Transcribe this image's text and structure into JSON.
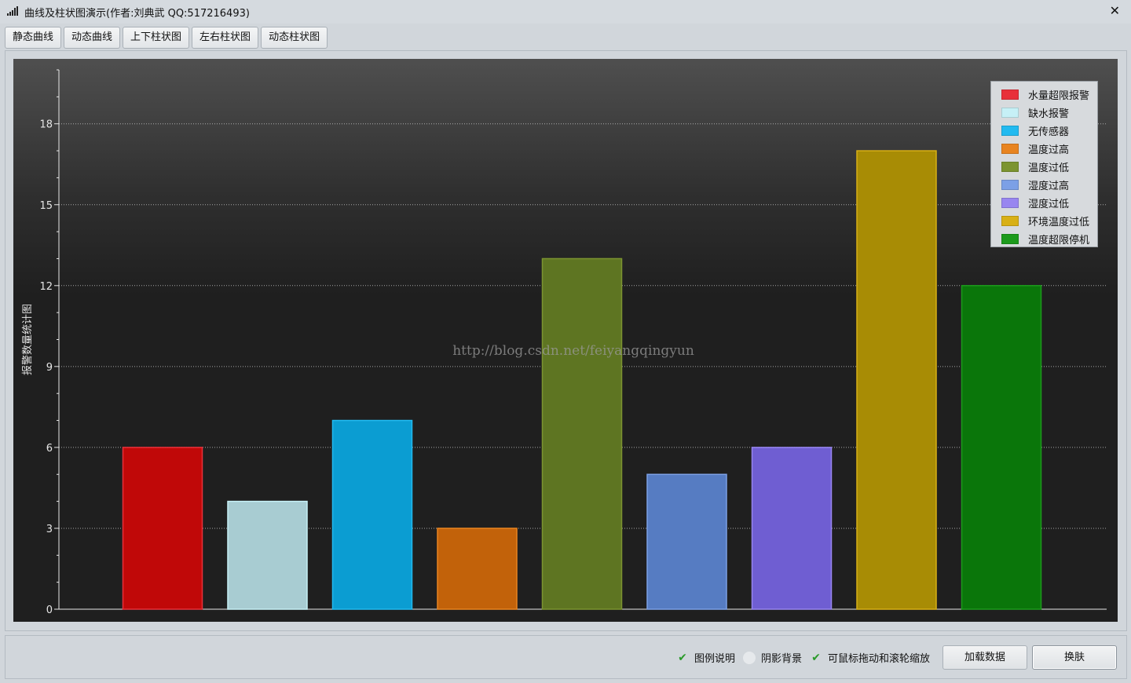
{
  "window": {
    "title": "曲线及柱状图演示(作者:刘典武 QQ:517216493)",
    "close_glyph": "✕"
  },
  "tabs": [
    {
      "label": "静态曲线"
    },
    {
      "label": "动态曲线"
    },
    {
      "label": "上下柱状图"
    },
    {
      "label": "左右柱状图"
    },
    {
      "label": "动态柱状图"
    }
  ],
  "watermark": "http://blog.csdn.net/feiyangqingyun",
  "chart_data": {
    "type": "bar",
    "ylabel": "报警数量统计图",
    "ylim": [
      0,
      20
    ],
    "yticks": [
      0,
      3,
      6,
      9,
      12,
      15,
      18
    ],
    "grid": true,
    "legend_placement": "top-right",
    "categories": [
      "水量超限报警",
      "缺水报警",
      "无传感器",
      "温度过高",
      "温度过低",
      "湿度过高",
      "湿度过低",
      "环境温度过低",
      "温度超限停机"
    ],
    "values": [
      6,
      4,
      7,
      3,
      13,
      5,
      6,
      17,
      12
    ],
    "colors": [
      "#c00808",
      "#a8ccd2",
      "#0b9dd2",
      "#c2620a",
      "#5e7522",
      "#567cc2",
      "#6f5ed2",
      "#a88c05",
      "#0a760a"
    ],
    "legend_colors": [
      "#e8303a",
      "#c6f0f6",
      "#22baf0",
      "#e88420",
      "#7c9430",
      "#7ca0e6",
      "#9886f0",
      "#d8b016",
      "#1c9a1c"
    ]
  },
  "bottom": {
    "checkboxes": [
      {
        "label": "图例说明",
        "checked": true
      },
      {
        "label": "阴影背景",
        "checked": false
      },
      {
        "label": "可鼠标拖动和滚轮缩放",
        "checked": true
      }
    ],
    "check_glyph": "✔",
    "buttons": [
      {
        "label": "加载数据"
      },
      {
        "label": "换肤"
      }
    ]
  }
}
